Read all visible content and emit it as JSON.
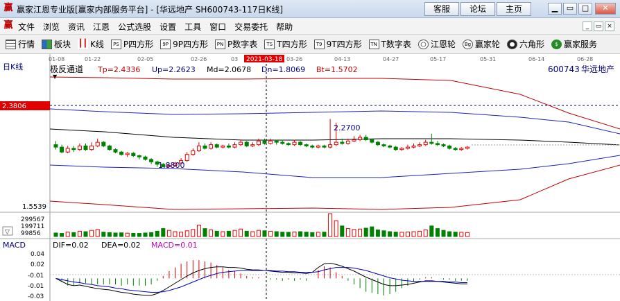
{
  "window": {
    "title": "赢家江恩专业版[赢家内部服务平台] - [华远地产  SH600743-117日K线]",
    "buttons": [
      "客服",
      "论坛",
      "主页"
    ]
  },
  "menu": [
    "文件",
    "浏览",
    "资讯",
    "江恩",
    "公式选股",
    "设置",
    "工具",
    "窗口",
    "交易委托",
    "帮助"
  ],
  "toolbar": [
    {
      "label": "行情",
      "icon": "grid-icon",
      "icon_text": ""
    },
    {
      "label": "板块",
      "icon": "blocks-icon",
      "icon_text": ""
    },
    {
      "label": "K线",
      "icon": "candlestick-icon",
      "icon_text": ""
    },
    {
      "label": "P四方形",
      "icon": "p-square-icon",
      "icon_text": "PS"
    },
    {
      "label": "9P四方形",
      "icon": "9p-square-icon",
      "icon_text": "9P"
    },
    {
      "label": "P数字表",
      "icon": "p-number-icon",
      "icon_text": "PN"
    },
    {
      "label": "T四方形",
      "icon": "t-square-icon",
      "icon_text": "TS"
    },
    {
      "label": "9T四方形",
      "icon": "9t-square-icon",
      "icon_text": "T9"
    },
    {
      "label": "T数字表",
      "icon": "t-number-icon",
      "icon_text": "TN"
    },
    {
      "label": "江恩轮",
      "icon": "gann-wheel-icon",
      "icon_text": ""
    },
    {
      "label": "赢家轮",
      "icon": "winner-wheel-icon",
      "icon_text": "Bg"
    },
    {
      "label": "六角形",
      "icon": "hexagon-icon",
      "icon_text": ""
    },
    {
      "label": "赢家服务",
      "icon": "dollar-icon",
      "icon_text": "$"
    }
  ],
  "colors": {
    "up": "#e00000",
    "down": "#008000",
    "band_outer": "#c00000",
    "band_mid": "#2020c0",
    "band_center": "#000000"
  },
  "kline": {
    "label": "日K线",
    "indicator_name": "极反通道",
    "params": [
      {
        "text": "Tp=2.4336",
        "color": "#c00000"
      },
      {
        "text": "Up=2.2623",
        "color": "#000080"
      },
      {
        "text": "Md=2.0678",
        "color": "#000000"
      },
      {
        "text": "Dn=1.8069",
        "color": "#000080"
      },
      {
        "text": "Bt=1.5702",
        "color": "#c00000"
      }
    ],
    "stock_code": "600743",
    "stock_name": "华远地产",
    "date_labels": [
      "01-08",
      "01-22",
      "02-05",
      "02-26",
      "03",
      "03-26",
      "04-13",
      "04-27",
      "05-17",
      "05-31",
      "06-14",
      "06-28"
    ],
    "highlight_date": "2021-03-18",
    "price_top_marker": "2.3806",
    "price_bottom_label": "1.5539",
    "high_annotation": "2.2700",
    "low_annotation": "1.8800",
    "volume_labels": [
      "299567",
      "199711",
      "99856"
    ]
  },
  "chart_data": {
    "type": "candlestick",
    "ylim": [
      1.5539,
      2.3806
    ],
    "candles": [
      [
        2.06,
        2.04,
        2.09,
        2.02
      ],
      [
        2.04,
        2.0,
        2.06,
        1.99
      ],
      [
        2.0,
        2.03,
        2.05,
        1.99
      ],
      [
        2.03,
        2.02,
        2.05,
        2.0
      ],
      [
        2.02,
        2.05,
        2.07,
        2.01
      ],
      [
        2.05,
        2.02,
        2.07,
        2.01
      ],
      [
        2.02,
        2.05,
        2.08,
        2.01
      ],
      [
        2.05,
        2.08,
        2.11,
        2.04
      ],
      [
        2.08,
        2.05,
        2.09,
        2.04
      ],
      [
        2.05,
        2.02,
        2.06,
        2.01
      ],
      [
        2.02,
        2.0,
        2.03,
        1.99
      ],
      [
        2.0,
        1.98,
        2.01,
        1.97
      ],
      [
        1.98,
        1.99,
        2.0,
        1.96
      ],
      [
        1.99,
        1.97,
        2.0,
        1.96
      ],
      [
        1.97,
        1.96,
        1.98,
        1.94
      ],
      [
        1.96,
        1.94,
        1.97,
        1.93
      ],
      [
        1.94,
        1.92,
        1.95,
        1.9
      ],
      [
        1.92,
        1.9,
        1.93,
        1.88
      ],
      [
        1.9,
        1.88,
        1.91,
        1.88
      ],
      [
        1.88,
        1.89,
        1.91,
        1.88
      ],
      [
        1.89,
        1.91,
        1.92,
        1.88
      ],
      [
        1.91,
        1.93,
        1.95,
        1.9
      ],
      [
        1.93,
        1.98,
        2.0,
        1.92
      ],
      [
        1.98,
        2.01,
        2.03,
        1.97
      ],
      [
        2.01,
        2.05,
        2.08,
        2.0
      ],
      [
        2.05,
        2.03,
        2.07,
        2.02
      ],
      [
        2.03,
        2.06,
        2.08,
        2.02
      ],
      [
        2.06,
        2.04,
        2.07,
        2.03
      ],
      [
        2.04,
        2.05,
        2.06,
        2.03
      ],
      [
        2.05,
        2.04,
        2.07,
        2.03
      ],
      [
        2.04,
        2.06,
        2.08,
        2.03
      ],
      [
        2.06,
        2.08,
        2.1,
        2.05
      ],
      [
        2.08,
        2.05,
        2.09,
        2.04
      ],
      [
        2.05,
        2.06,
        2.08,
        2.04
      ],
      [
        2.06,
        2.09,
        2.11,
        2.05
      ],
      [
        2.09,
        2.07,
        2.11,
        2.06
      ],
      [
        2.07,
        2.09,
        2.11,
        2.06
      ],
      [
        2.09,
        2.08,
        2.1,
        2.06
      ],
      [
        2.08,
        2.07,
        2.1,
        2.06
      ],
      [
        2.07,
        2.06,
        2.08,
        2.05
      ],
      [
        2.06,
        2.08,
        2.1,
        2.05
      ],
      [
        2.08,
        2.06,
        2.09,
        2.05
      ],
      [
        2.06,
        2.05,
        2.07,
        2.04
      ],
      [
        2.05,
        2.04,
        2.06,
        2.03
      ],
      [
        2.04,
        2.05,
        2.06,
        2.03
      ],
      [
        2.05,
        2.04,
        2.06,
        2.03
      ],
      [
        2.04,
        2.06,
        2.27,
        2.03
      ],
      [
        2.06,
        2.08,
        2.24,
        2.05
      ],
      [
        2.08,
        2.07,
        2.11,
        2.06
      ],
      [
        2.07,
        2.09,
        2.11,
        2.06
      ],
      [
        2.09,
        2.1,
        2.13,
        2.08
      ],
      [
        2.1,
        2.12,
        2.14,
        2.09
      ],
      [
        2.12,
        2.1,
        2.14,
        2.09
      ],
      [
        2.1,
        2.08,
        2.11,
        2.07
      ],
      [
        2.08,
        2.06,
        2.09,
        2.05
      ],
      [
        2.06,
        2.05,
        2.07,
        2.04
      ],
      [
        2.05,
        2.04,
        2.06,
        2.03
      ],
      [
        2.04,
        2.02,
        2.05,
        2.01
      ],
      [
        2.02,
        2.03,
        2.04,
        2.01
      ],
      [
        2.03,
        2.04,
        2.06,
        2.02
      ],
      [
        2.04,
        2.05,
        2.07,
        2.03
      ],
      [
        2.05,
        2.06,
        2.08,
        2.04
      ],
      [
        2.06,
        2.08,
        2.1,
        2.05
      ],
      [
        2.08,
        2.07,
        2.15,
        2.06
      ],
      [
        2.07,
        2.06,
        2.09,
        2.05
      ],
      [
        2.06,
        2.05,
        2.07,
        2.04
      ],
      [
        2.05,
        2.03,
        2.06,
        2.02
      ],
      [
        2.03,
        2.02,
        2.04,
        2.01
      ],
      [
        2.02,
        2.03,
        2.04,
        2.01
      ],
      [
        2.03,
        2.04,
        2.05,
        2.02
      ]
    ],
    "volumes": [
      40,
      35,
      50,
      45,
      60,
      55,
      70,
      80,
      50,
      45,
      40,
      42,
      38,
      36,
      35,
      40,
      45,
      60,
      90,
      70,
      55,
      50,
      65,
      80,
      130,
      90,
      75,
      60,
      55,
      60,
      70,
      85,
      60,
      55,
      70,
      65,
      60,
      55,
      50,
      48,
      52,
      55,
      50,
      45,
      48,
      50,
      260,
      180,
      120,
      90,
      80,
      85,
      95,
      110,
      75,
      65,
      55,
      50,
      48,
      52,
      55,
      60,
      75,
      120,
      90,
      70,
      55,
      50,
      48,
      45
    ],
    "macd": {
      "dif": [
        0.0,
        -0.005,
        -0.01,
        -0.012,
        -0.011,
        -0.013,
        -0.015,
        -0.017,
        -0.018,
        -0.019,
        -0.021,
        -0.023,
        -0.024,
        -0.026,
        -0.027,
        -0.028,
        -0.028,
        -0.025,
        -0.02,
        -0.014,
        -0.008,
        -0.002,
        0.004,
        0.009,
        0.013,
        0.016,
        0.018,
        0.019,
        0.019,
        0.018,
        0.018,
        0.017,
        0.015,
        0.014,
        0.014,
        0.013,
        0.012,
        0.011,
        0.01,
        0.01,
        0.009,
        0.009,
        0.008,
        0.01,
        0.018,
        0.024,
        0.025,
        0.023,
        0.02,
        0.016,
        0.012,
        0.007,
        0.002,
        -0.002,
        -0.006,
        -0.01,
        -0.012,
        -0.012,
        -0.011,
        -0.01,
        -0.008,
        -0.006,
        -0.004,
        -0.004,
        -0.005,
        -0.006,
        -0.007,
        -0.008,
        -0.009,
        -0.009
      ],
      "dea": [
        0.0,
        -0.002,
        -0.004,
        -0.006,
        -0.007,
        -0.009,
        -0.01,
        -0.012,
        -0.013,
        -0.014,
        -0.016,
        -0.017,
        -0.019,
        -0.02,
        -0.021,
        -0.022,
        -0.023,
        -0.023,
        -0.022,
        -0.02,
        -0.017,
        -0.014,
        -0.01,
        -0.006,
        -0.002,
        0.002,
        0.005,
        0.008,
        0.01,
        0.011,
        0.012,
        0.013,
        0.013,
        0.013,
        0.013,
        0.013,
        0.013,
        0.012,
        0.012,
        0.011,
        0.011,
        0.01,
        0.01,
        0.01,
        0.011,
        0.014,
        0.016,
        0.018,
        0.018,
        0.018,
        0.017,
        0.015,
        0.013,
        0.01,
        0.007,
        0.004,
        0.001,
        -0.001,
        -0.003,
        -0.004,
        -0.005,
        -0.005,
        -0.005,
        -0.005,
        -0.005,
        -0.005,
        -0.006,
        -0.006,
        -0.007,
        -0.007
      ],
      "ylim": [
        -0.035,
        0.045
      ]
    }
  },
  "macd": {
    "label": "MACD",
    "dif_text": "DIF=0.02",
    "dea_text": "DEA=0.02",
    "macd_text": "MACD=0.01",
    "axis_labels": [
      "0.04",
      "0.02",
      "-0.01",
      "-0.01",
      "-0.03"
    ]
  }
}
